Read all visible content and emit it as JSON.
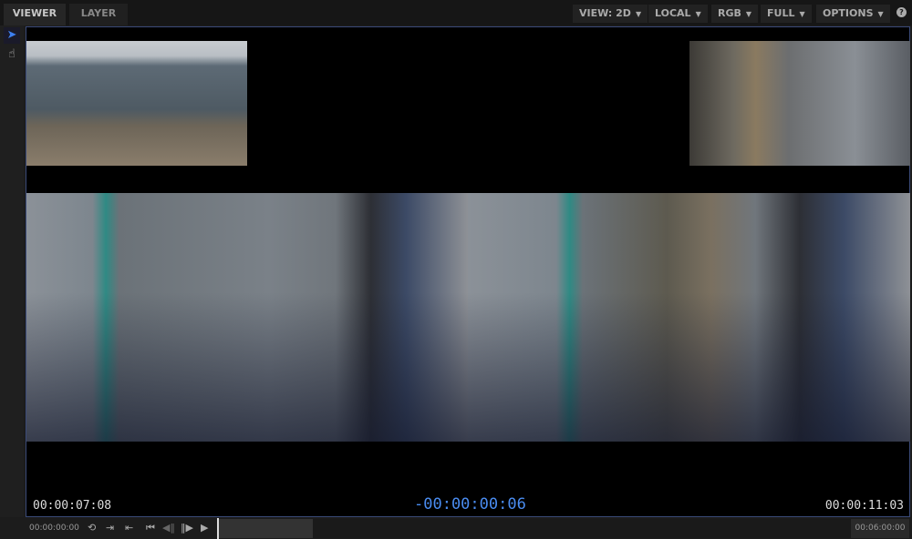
{
  "tabs": [
    {
      "label": "VIEWER",
      "active": true
    },
    {
      "label": "LAYER",
      "active": false
    }
  ],
  "menus": [
    {
      "label": "VIEW: 2D"
    },
    {
      "label": "LOCAL"
    },
    {
      "label": "RGB"
    },
    {
      "label": "FULL"
    },
    {
      "label": "OPTIONS"
    }
  ],
  "help_label": "?",
  "tools": [
    {
      "icon": "pointer-icon"
    },
    {
      "icon": "hand-icon"
    }
  ],
  "viewer": {
    "left_timecode": "00:00:07:08",
    "center_timecode": "-00:00:00:06",
    "right_timecode": "00:00:11:03"
  },
  "transport": {
    "start_time": "00:00:00:00",
    "end_time": "00:06:00:00"
  },
  "colors": {
    "accent": "#4a8cf0",
    "border": "#3a4a78"
  }
}
